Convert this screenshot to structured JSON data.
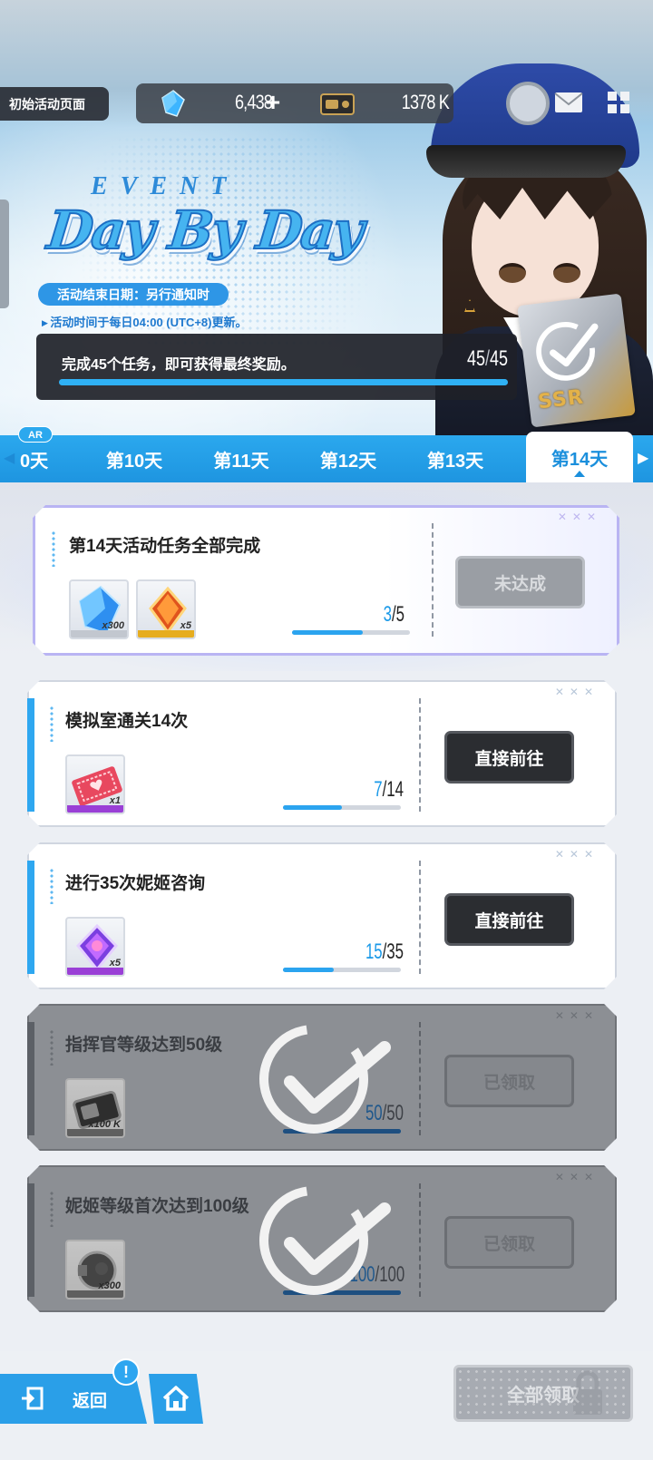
{
  "header": {
    "back_to_event_label": "初始活动页面",
    "gem_amount": "6,438",
    "gem_plus": "+",
    "credit_amount": "1378 K"
  },
  "event": {
    "event_word": "EVENT",
    "title": "Day By Day",
    "end_date": "活动结束日期：另行通知时",
    "refresh_note": "活动时间于每日04:00 (UTC+8)更新。",
    "progress_text": "完成45个任务，即可获得最终奖励。",
    "progress_current": "45",
    "progress_total": "45",
    "progress_fraction": 1.0,
    "reward_label": "SSR"
  },
  "tabs": {
    "badge": "AR",
    "partial": "0天",
    "items": [
      "第10天",
      "第11天",
      "第12天",
      "第13天",
      "第14天"
    ],
    "active": "第14天"
  },
  "missions": [
    {
      "title": "第14天活动任务全部完成",
      "current": "3",
      "total": "5",
      "fraction": 0.6,
      "button": "未达成",
      "state": "incomplete",
      "rewards": [
        {
          "icon": "blue-gem-icon",
          "qty": "x300"
        },
        {
          "icon": "orange-gem-icon",
          "qty": "x5"
        }
      ]
    },
    {
      "title": "模拟室通关14次",
      "current": "7",
      "total": "14",
      "fraction": 0.5,
      "button": "直接前往",
      "state": "go",
      "rewards": [
        {
          "icon": "ticket-icon",
          "qty": "x1"
        }
      ]
    },
    {
      "title": "进行35次妮姬咨询",
      "current": "15",
      "total": "35",
      "fraction": 0.43,
      "button": "直接前往",
      "state": "go",
      "rewards": [
        {
          "icon": "purple-gem-icon",
          "qty": "x5"
        }
      ]
    },
    {
      "title": "指挥官等级达到50级",
      "current": "50",
      "total": "50",
      "fraction": 1.0,
      "button": "已领取",
      "state": "claimed",
      "rewards": [
        {
          "icon": "credit-case-icon",
          "qty": "x100 K"
        }
      ]
    },
    {
      "title": "妮姬等级首次达到100级",
      "current": "100",
      "total": "100",
      "fraction": 1.0,
      "button": "已领取",
      "state": "claimed",
      "rewards": [
        {
          "icon": "core-dust-icon",
          "qty": "x300"
        }
      ]
    }
  ],
  "footer": {
    "back_label": "返回",
    "notice": "!",
    "claim_all": "全部领取"
  },
  "colors": {
    "accent": "#2ba8ee",
    "dark_button": "#2b2d31",
    "disabled": "#9a9ea4"
  }
}
